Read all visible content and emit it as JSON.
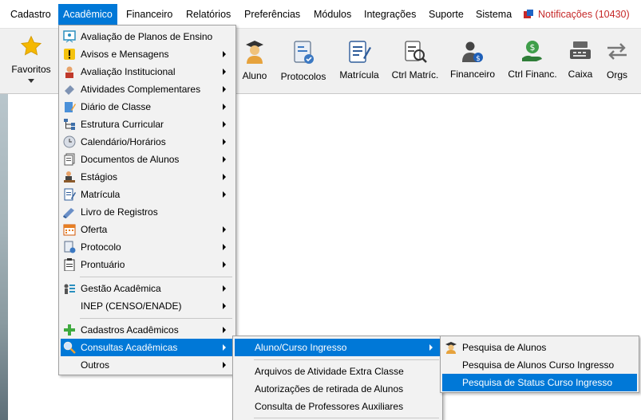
{
  "menubar": {
    "items": [
      {
        "label": "Cadastro"
      },
      {
        "label": "Acadêmico"
      },
      {
        "label": "Financeiro"
      },
      {
        "label": "Relatórios"
      },
      {
        "label": "Preferências"
      },
      {
        "label": "Módulos"
      },
      {
        "label": "Integrações"
      },
      {
        "label": "Suporte"
      },
      {
        "label": "Sistema"
      }
    ],
    "notifications": "Notificações (10430)"
  },
  "toolbar": {
    "favoritos": "Favoritos",
    "aluno": "Aluno",
    "protocolos": "Protocolos",
    "matricula": "Matrícula",
    "ctrl_matric": "Ctrl Matríc.",
    "financeiro": "Financeiro",
    "ctrl_financ": "Ctrl Financ.",
    "caixa": "Caixa",
    "orgs": "Orgs"
  },
  "academico_menu": {
    "items": [
      "Avaliação de Planos de Ensino",
      "Avisos e Mensagens",
      "Avaliação Institucional",
      "Atividades Complementares",
      "Diário de Classe",
      "Estrutura Curricular",
      "Calendário/Horários",
      "Documentos de Alunos",
      "Estágios",
      "Matrícula",
      "Livro de Registros",
      "Oferta",
      "Protocolo",
      "Prontuário",
      "Gestão Acadêmica",
      "INEP (CENSO/ENADE)",
      "Cadastros Acadêmicos",
      "Consultas Acadêmicas",
      "Outros"
    ]
  },
  "consultas_menu": {
    "items": [
      "Aluno/Curso Ingresso",
      "Arquivos de Atividade Extra Classe",
      "Autorizações de retirada de Alunos",
      "Consulta de Professores Auxiliares"
    ]
  },
  "aluno_curso_menu": {
    "items": [
      "Pesquisa de Alunos",
      "Pesquisa de Alunos Curso Ingresso",
      "Pesquisa de Status Curso Ingresso"
    ]
  },
  "colors": {
    "highlight": "#0078d7",
    "notification": "#c62828"
  }
}
